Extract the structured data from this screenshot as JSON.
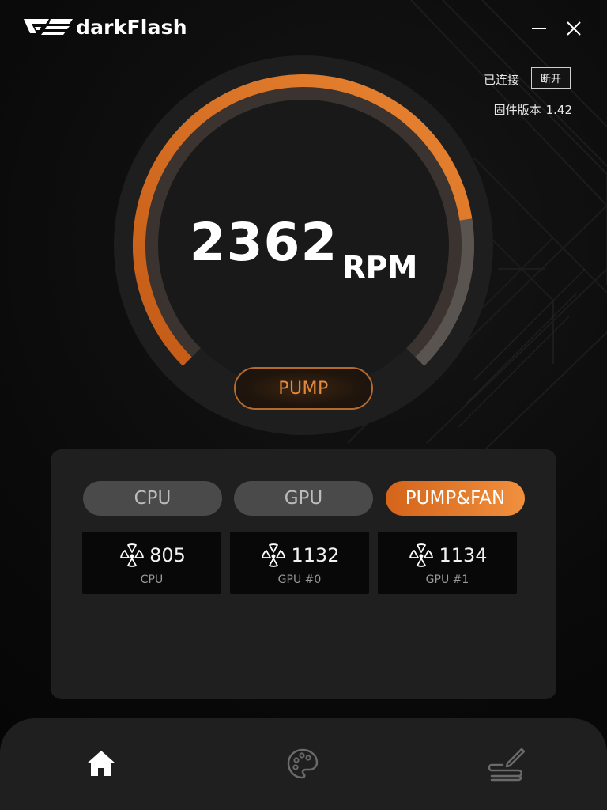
{
  "app": {
    "brand_name": "darkFlash",
    "accent_color": "#e07a2c"
  },
  "titlebar": {
    "minimize_icon": "minimize-icon",
    "close_icon": "close-icon"
  },
  "status": {
    "connection_label": "已连接",
    "disconnect_label": "断开",
    "firmware_label": "固件版本",
    "firmware_version": "1.42"
  },
  "gauge": {
    "value": "2362",
    "unit": "RPM",
    "fill_fraction": 0.8,
    "fill_color_start": "#c45a16",
    "fill_color_end": "#e88532",
    "track_color": "#5a5450"
  },
  "mode_button": {
    "label": "PUMP"
  },
  "tabs": [
    {
      "label": "CPU",
      "active": false
    },
    {
      "label": "GPU",
      "active": false
    },
    {
      "label": "PUMP&FAN",
      "active": true
    }
  ],
  "fans": [
    {
      "icon": "fan-icon",
      "value": "805",
      "label": "CPU"
    },
    {
      "icon": "fan-icon",
      "value": "1132",
      "label": "GPU #0"
    },
    {
      "icon": "fan-icon",
      "value": "1134",
      "label": "GPU #1"
    }
  ],
  "bottom_nav": [
    {
      "icon": "home-icon",
      "active": true
    },
    {
      "icon": "palette-icon",
      "active": false
    },
    {
      "icon": "edit-icon",
      "active": false
    }
  ]
}
